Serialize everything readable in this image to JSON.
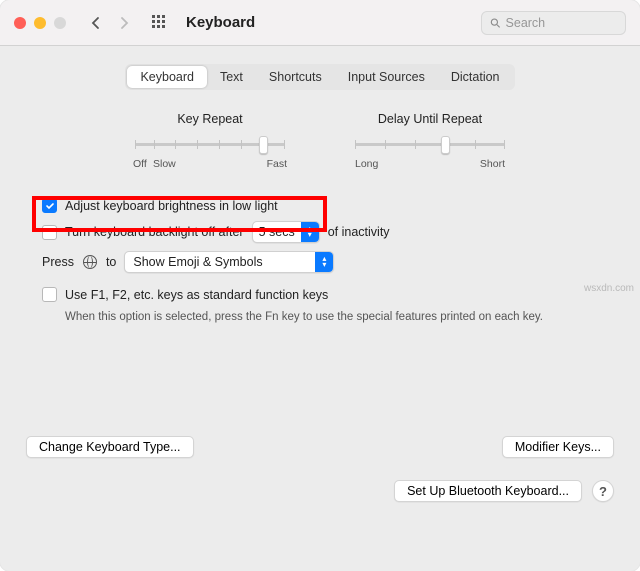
{
  "titlebar": {
    "title": "Keyboard",
    "search_placeholder": "Search"
  },
  "tabs": [
    "Keyboard",
    "Text",
    "Shortcuts",
    "Input Sources",
    "Dictation"
  ],
  "sliders": {
    "keyrepeat": {
      "label": "Key Repeat",
      "left": "Off",
      "left2": "Slow",
      "right": "Fast"
    },
    "delay": {
      "label": "Delay Until Repeat",
      "left": "Long",
      "right": "Short"
    }
  },
  "options": {
    "adjust": "Adjust keyboard brightness in low light",
    "backlight_pre": "Turn keyboard backlight off after",
    "backlight_val": "5 secs",
    "backlight_post": "of inactivity",
    "press": "Press",
    "to": "to",
    "emoji": "Show Emoji & Symbols",
    "fn": "Use F1, F2, etc. keys as standard function keys",
    "fn_desc": "When this option is selected, press the Fn key to use the special features printed on each key."
  },
  "buttons": {
    "change_type": "Change Keyboard Type...",
    "modifier": "Modifier Keys...",
    "bluetooth": "Set Up Bluetooth Keyboard...",
    "help": "?"
  },
  "watermark": "wsxdn.com"
}
